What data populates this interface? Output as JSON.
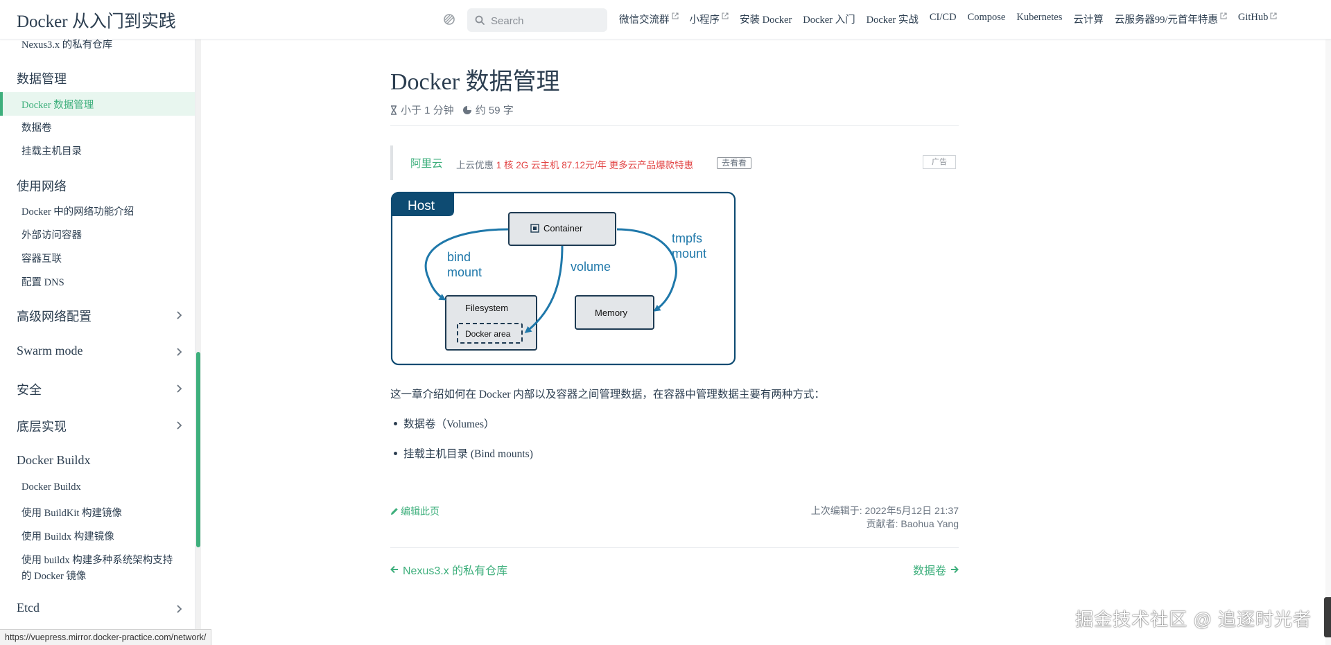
{
  "navbar": {
    "site_name": "Docker 从入门到实践",
    "search_placeholder": "Search",
    "links": [
      {
        "label": "微信交流群",
        "external": true
      },
      {
        "label": "小程序",
        "external": true
      },
      {
        "label": "安装 Docker",
        "external": false
      },
      {
        "label": "Docker 入门",
        "external": false
      },
      {
        "label": "Docker 实战",
        "external": false
      },
      {
        "label": "CI/CD",
        "external": false
      },
      {
        "label": "Compose",
        "external": false
      },
      {
        "label": "Kubernetes",
        "external": false
      },
      {
        "label": "云计算",
        "external": false
      },
      {
        "label": "云服务器99/元首年特惠",
        "external": true
      },
      {
        "label": "GitHub",
        "external": true
      }
    ]
  },
  "sidebar": {
    "prev_item": "Nexus3.x 的私有仓库",
    "group_data": "数据管理",
    "active_item": "Docker 数据管理",
    "data_items": [
      "数据卷",
      "挂载主机目录"
    ],
    "group_network": "使用网络",
    "network_items": [
      "Docker 中的网络功能介绍",
      "外部访问容器",
      "容器互联",
      "配置 DNS"
    ],
    "collapsibles": [
      "高级网络配置",
      "Swarm mode",
      "安全",
      "底层实现"
    ],
    "group_buildx": "Docker Buildx",
    "buildx_items": [
      "Docker Buildx",
      "使用 BuildKit 构建镜像",
      "使用 Buildx 构建镜像",
      "使用 buildx 构建多种系统架构支持",
      "的 Docker 镜像"
    ],
    "etcd": "Etcd"
  },
  "content": {
    "title": "Docker 数据管理",
    "read_time": "小于 1 分钟",
    "word_count": "约 59 字",
    "ad": {
      "brand": "阿里云",
      "text_plain": "上云优惠",
      "text_highlight": "1 核 2G 云主机 87.12元/年 更多云产品爆款特惠",
      "button": "去看看",
      "tag": "广告"
    },
    "diagram": {
      "host": "Host",
      "container": "Container",
      "bind_mount_1": "bind",
      "bind_mount_2": "mount",
      "volume": "volume",
      "tmpfs_1": "tmpfs",
      "tmpfs_2": "mount",
      "filesystem": "Filesystem",
      "docker_area": "Docker area",
      "memory": "Memory"
    },
    "intro": "这一章介绍如何在 Docker 内部以及容器之间管理数据，在容器中管理数据主要有两种方式：",
    "bullets": [
      "数据卷（Volumes）",
      "挂载主机目录 (Bind mounts)"
    ],
    "edit_link": "编辑此页",
    "last_updated_label": "上次编辑于: 2022年5月12日 21:37",
    "contributors": "贡献者: Baohua Yang",
    "prev_page": "Nexus3.x 的私有仓库",
    "next_page": "数据卷"
  },
  "overlay": {
    "watermark": "掘金技术社区 @ 追逐时光者",
    "status_url": "https://vuepress.mirror.docker-practice.com/network/"
  },
  "colors": {
    "accent": "#3eaf7c",
    "text": "#2c3e50",
    "diagram_blue": "#1f78aa",
    "diagram_navy": "#0e4b72",
    "ad_red": "#e24444"
  }
}
